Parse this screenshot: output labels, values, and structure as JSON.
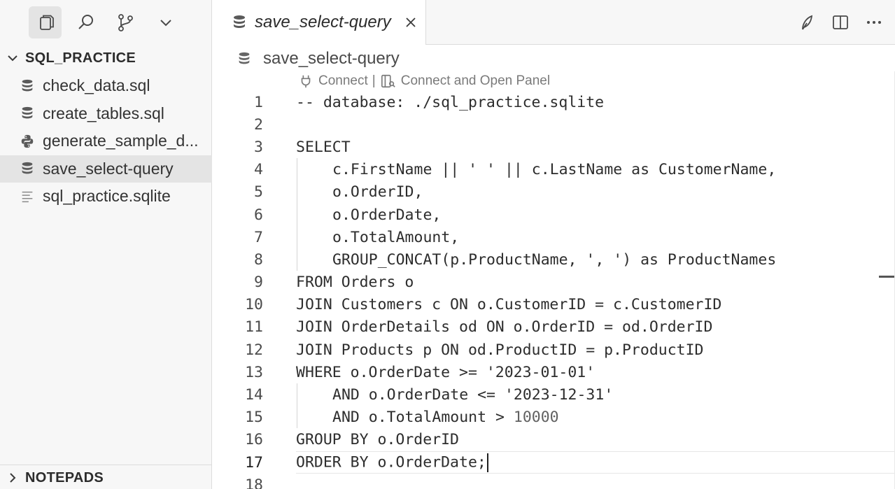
{
  "sidebar": {
    "activity_icons": [
      "explorer-icon",
      "search-icon",
      "source-control-icon",
      "chevron-down-icon"
    ],
    "workspace_title": "SQL_PRACTICE",
    "files": [
      {
        "name": "check_data.sql",
        "icon": "database-icon"
      },
      {
        "name": "create_tables.sql",
        "icon": "database-icon"
      },
      {
        "name": "generate_sample_d...",
        "icon": "python-icon"
      },
      {
        "name": "save_select-query",
        "icon": "database-icon",
        "selected": true
      },
      {
        "name": "sql_practice.sqlite",
        "icon": "text-file-icon"
      }
    ],
    "notepads_title": "NOTEPADS"
  },
  "editor": {
    "tab": {
      "label": "save_select-query",
      "icon": "database-icon"
    },
    "tab_actions": [
      "feather-icon",
      "split-editor-icon",
      "more-actions-icon"
    ],
    "breadcrumb": "save_select-query",
    "codelens": {
      "connect": "Connect",
      "separator": "|",
      "connect_panel": "Connect and Open Panel"
    },
    "current_line": 17,
    "lines": [
      {
        "n": "1",
        "text": "-- database: ./sql_practice.sqlite"
      },
      {
        "n": "2",
        "text": ""
      },
      {
        "n": "3",
        "text": "SELECT"
      },
      {
        "n": "4",
        "text": "c.FirstName || ' ' || c.LastName as CustomerName,"
      },
      {
        "n": "5",
        "text": "o.OrderID,"
      },
      {
        "n": "6",
        "text": "o.OrderDate,"
      },
      {
        "n": "7",
        "text": "o.TotalAmount,"
      },
      {
        "n": "8",
        "text": "GROUP_CONCAT(p.ProductName, ', ') as ProductNames"
      },
      {
        "n": "9",
        "text": "FROM Orders o"
      },
      {
        "n": "10",
        "text": "JOIN Customers c ON o.CustomerID = c.CustomerID"
      },
      {
        "n": "11",
        "text": "JOIN OrderDetails od ON o.OrderID = od.OrderID"
      },
      {
        "n": "12",
        "text": "JOIN Products p ON od.ProductID = p.ProductID"
      },
      {
        "n": "13",
        "text": "WHERE o.OrderDate >= '2023-01-01'"
      },
      {
        "n": "14",
        "text": "AND o.OrderDate <= '2023-12-31'"
      },
      {
        "n": "15",
        "text": "AND o.TotalAmount > ",
        "num": "10000"
      },
      {
        "n": "16",
        "text": "GROUP BY o.OrderID"
      },
      {
        "n": "17",
        "text": "ORDER BY o.OrderDate;"
      },
      {
        "n": "18",
        "text": ""
      }
    ]
  }
}
